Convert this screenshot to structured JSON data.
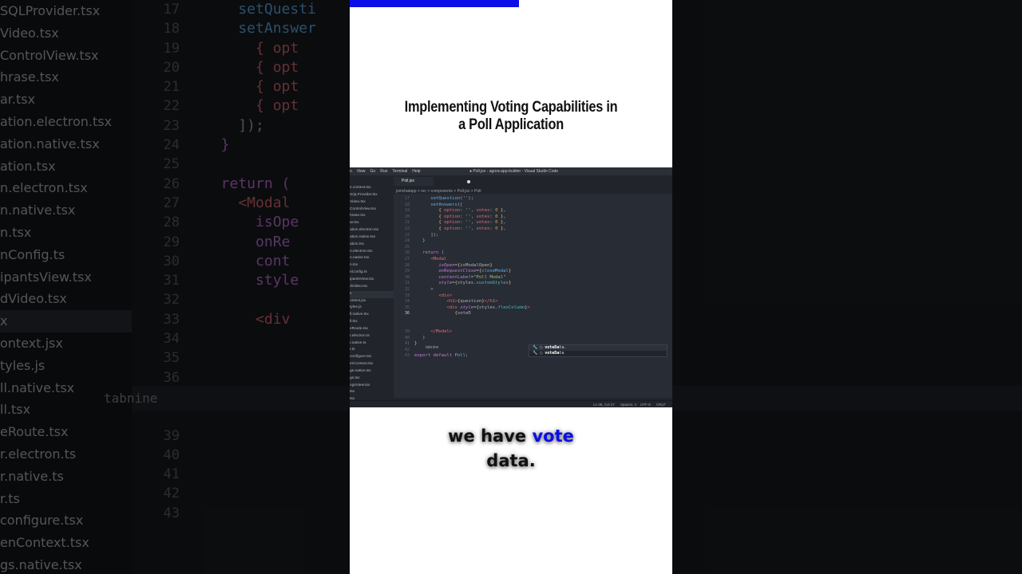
{
  "background": {
    "files": [
      "SQLProvider.tsx",
      "Video.tsx",
      "ControlView.tsx",
      "hrase.tsx",
      "ar.tsx",
      "ation.electron.tsx",
      "ation.native.tsx",
      "ation.tsx",
      "n.electron.tsx",
      "n.native.tsx",
      "n.tsx",
      "nConfig.ts",
      "ipantsView.tsx",
      "dVideo.tsx",
      "x",
      "ontext.jsx",
      "tyles.js",
      "ll.native.tsx",
      "ll.tsx",
      "eRoute.tsx",
      "r.electron.ts",
      "r.native.ts",
      "r.ts",
      "configure.tsx",
      "enContext.tsx",
      "gs.native.tsx"
    ],
    "line_numbers": [
      "17",
      "18",
      "19",
      "20",
      "21",
      "22",
      "23",
      "24",
      "25",
      "26",
      "27",
      "28",
      "29",
      "30",
      "31",
      "32",
      "33",
      "34",
      "35",
      "36",
      "",
      "",
      "39",
      "40",
      "41",
      "42",
      "43"
    ],
    "code_lines": [
      "setQuesti",
      "setAnswer",
      "{ opt",
      "{ opt",
      "{ opt",
      "{ opt",
      "]);",
      "}",
      "",
      "return (",
      "<Modal",
      "isOpe",
      "onRe",
      "cont",
      "style",
      "",
      "<div",
      "",
      "",
      ""
    ],
    "tabnine": "tabnine"
  },
  "progress": {
    "fraction": 0.525
  },
  "title": "Implementing Voting Capabilities in a Poll Application",
  "vscode": {
    "menu": [
      "n",
      "View",
      "Go",
      "Run",
      "Terminal",
      "Help"
    ],
    "window_title": "● Poll.jsx - agora-app-builder - Visual Studio Code",
    "tab": "Poll.jsx",
    "breadcrumb": "jsmchatapp  >  src  >  components  >  Poll.jsx  >  Poll",
    "sidebar": [
      "s.context.tsx",
      "SQLProvider.tsx",
      "Video.tsx",
      "ControlView.tsx",
      "hrase.tsx",
      "ar.tsx",
      "ation.electron.tsx",
      "ation.native.tsx",
      "ation.tsx",
      "n.electron.tsx",
      "n.native.tsx",
      "n.tsx",
      "nConfig.ts",
      "ipantsView.tsx",
      "dVideo.tsx",
      "x",
      "ontext.jsx",
      "tyles.js",
      "ll.native.tsx",
      "ll.tsx",
      "eRoute.tsx",
      "r.electron.ts",
      "r.native.ts",
      "r.ts",
      "configure.tsx",
      "enContext.tsx",
      "gs.native.tsx",
      "gs.tsx",
      "ngsView.tsx",
      "tsx",
      "tsx",
      "nContext.tsx"
    ],
    "gutter": [
      "17",
      "18",
      "19",
      "20",
      "21",
      "22",
      "23",
      "24",
      "25",
      "26",
      "27",
      "28",
      "29",
      "30",
      "31",
      "32",
      "33",
      "34",
      "35",
      "36",
      "",
      "",
      "39",
      "40",
      "41",
      "42",
      "43"
    ],
    "tabnine": "tabnine",
    "suggestions": [
      {
        "match": "voteDa",
        "rest": "ta."
      },
      {
        "match": "voteDa",
        "rest": "ta"
      }
    ],
    "status": {
      "position": "Ln 36, Col 27",
      "spaces": "Spaces: 4",
      "encoding": "UTF-8",
      "eol": "CRLF"
    }
  },
  "caption": {
    "before": "we have ",
    "highlight": "vote",
    "after": "data."
  }
}
